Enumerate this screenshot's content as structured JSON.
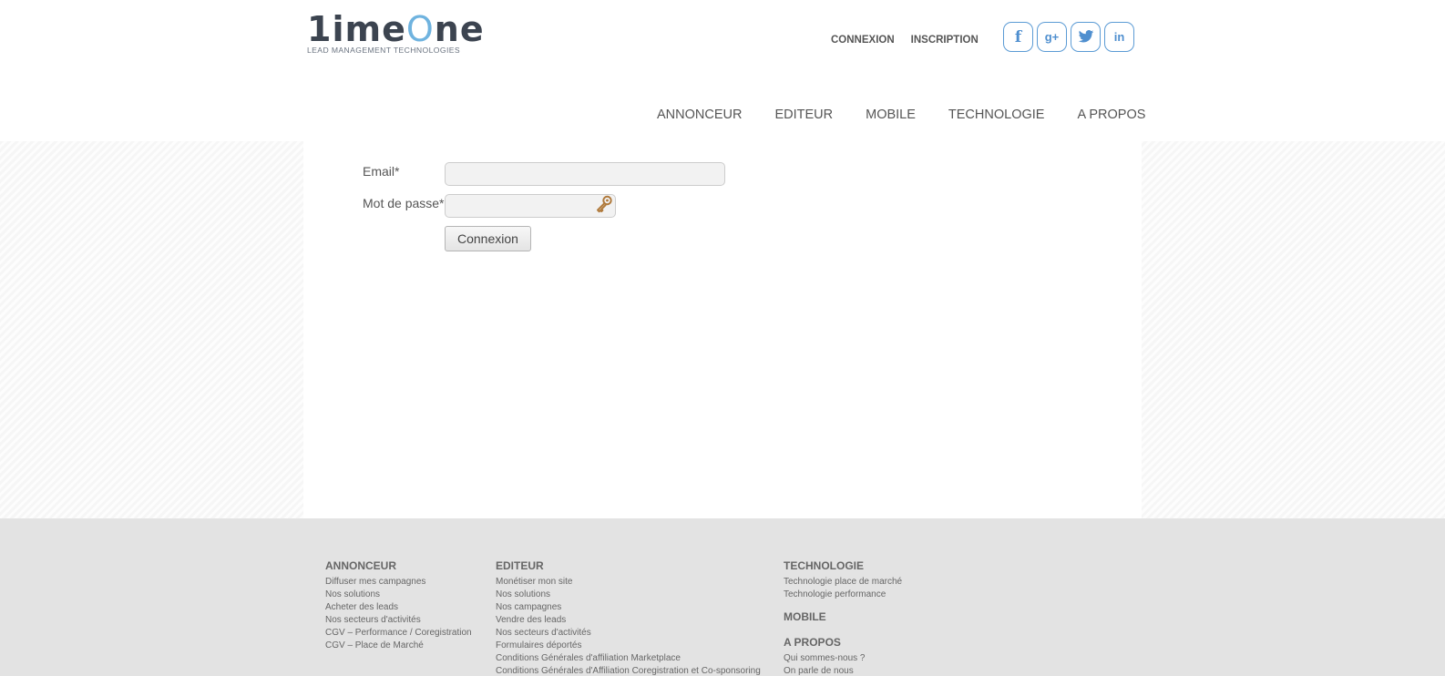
{
  "brand": {
    "logo_prefix": "1",
    "logo_time": "ime",
    "logo_o": "O",
    "logo_ne": "ne",
    "tagline": "LEAD MANAGEMENT TECHNOLOGIES"
  },
  "toplinks": {
    "login": "CONNEXION",
    "signup": "INSCRIPTION"
  },
  "socials": [
    {
      "icon": "facebook-icon",
      "glyph": "f"
    },
    {
      "icon": "google-plus-icon",
      "glyph": "g+"
    },
    {
      "icon": "twitter-icon",
      "glyph": "t"
    },
    {
      "icon": "linkedin-icon",
      "glyph": "in"
    }
  ],
  "nav": [
    "ANNONCEUR",
    "EDITEUR",
    "MOBILE",
    "TECHNOLOGIE",
    "A PROPOS"
  ],
  "form": {
    "email_label": "Email*",
    "email_value": "",
    "password_label": "Mot de passe*",
    "password_value": "",
    "submit_label": "Connexion"
  },
  "footer": {
    "annonceur": {
      "title": "ANNONCEUR",
      "links": [
        "Diffuser mes campagnes",
        "Nos solutions",
        "Acheter des leads",
        "Nos secteurs d'activités",
        "CGV – Performance / Coregistration",
        "CGV – Place de Marché"
      ]
    },
    "editeur": {
      "title": "EDITEUR",
      "links": [
        "Monétiser mon site",
        "Nos solutions",
        "Nos campagnes",
        "Vendre des leads",
        "Nos secteurs d'activités",
        "Formulaires déportés",
        "Conditions Générales d'affiliation Marketplace",
        "Conditions Générales d'Affiliation Coregistration et Co-sponsoring"
      ]
    },
    "technologie": {
      "title": "TECHNOLOGIE",
      "links": [
        "Technologie place de marché",
        "Technologie performance"
      ]
    },
    "mobile": {
      "title": "MOBILE"
    },
    "apropos": {
      "title": "A PROPOS",
      "links": [
        "Qui sommes-nous ?",
        "On parle de nous"
      ]
    }
  },
  "colors": {
    "accent": "#6fb3df",
    "social": "#5b9bd5",
    "footer_bg": "#e3e3e3",
    "text": "#555555"
  }
}
